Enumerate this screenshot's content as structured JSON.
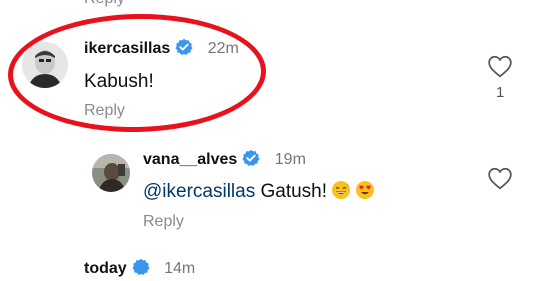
{
  "top_reply": {
    "label": "Reply"
  },
  "comment_main": {
    "username": "ikercasillas",
    "time": "22m",
    "text": "Kabush!",
    "reply_label": "Reply",
    "like_count": "1",
    "verified": true
  },
  "comment_reply": {
    "username": "vana__alves",
    "time": "19m",
    "mention": "@ikercasillas",
    "text": "Gatush!",
    "emojis": [
      "grinning-sweat-emoji",
      "heart-eyes-emoji"
    ],
    "reply_label": "Reply",
    "verified": true
  },
  "next_comment": {
    "username": "today",
    "time": "14m"
  },
  "colors": {
    "verified_blue": "#3797f0",
    "highlight_red": "#e8121c",
    "mention_blue": "#00376b",
    "muted_gray": "#8a8a8a"
  }
}
